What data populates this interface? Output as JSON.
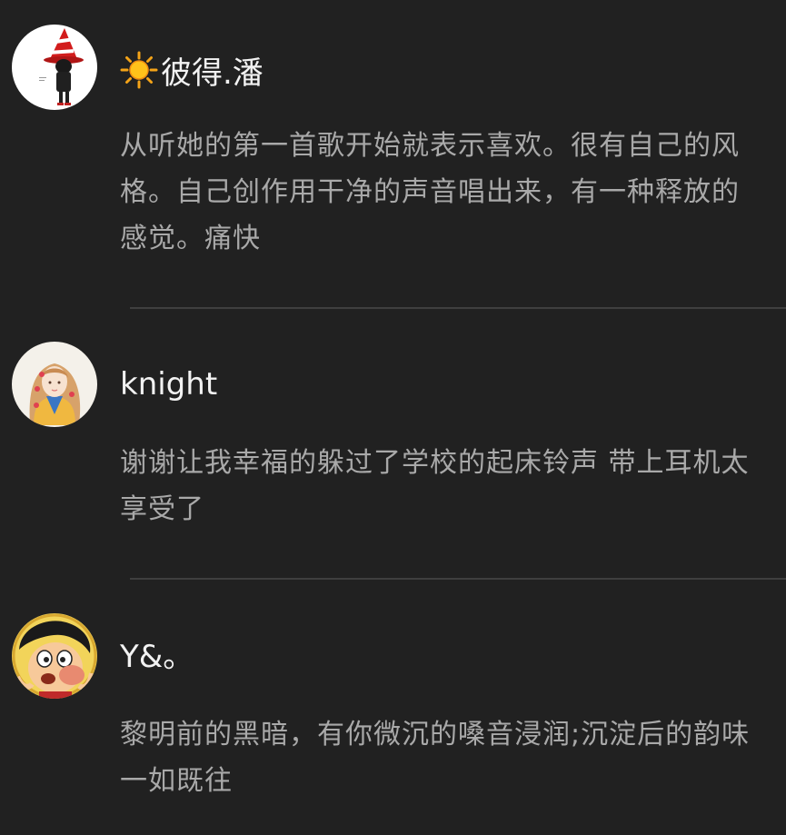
{
  "comments": [
    {
      "username": "彼得.潘",
      "avatar": "avatar-witch-hat-icon",
      "has_sun_emoji": true,
      "text": "从听她的第一首歌开始就表示喜欢。很有自己的风格。自己创作用干净的声音唱出来，有一种释放的感觉。痛快"
    },
    {
      "username": "knight",
      "avatar": "avatar-girl-illustration-icon",
      "has_sun_emoji": false,
      "text": "谢谢让我幸福的躲过了学校的起床铃声 带上耳机太享受了"
    },
    {
      "username": "Y&。",
      "avatar": "avatar-cartoon-boy-icon",
      "has_sun_emoji": false,
      "text": "黎明前的黑暗，有你微沉的嗓音浸润;沉淀后的韵味一如既往"
    }
  ],
  "colors": {
    "background": "#212121",
    "username": "#f2f2f2",
    "body_text": "#a9a9a9",
    "divider": "#3f3f3f"
  }
}
